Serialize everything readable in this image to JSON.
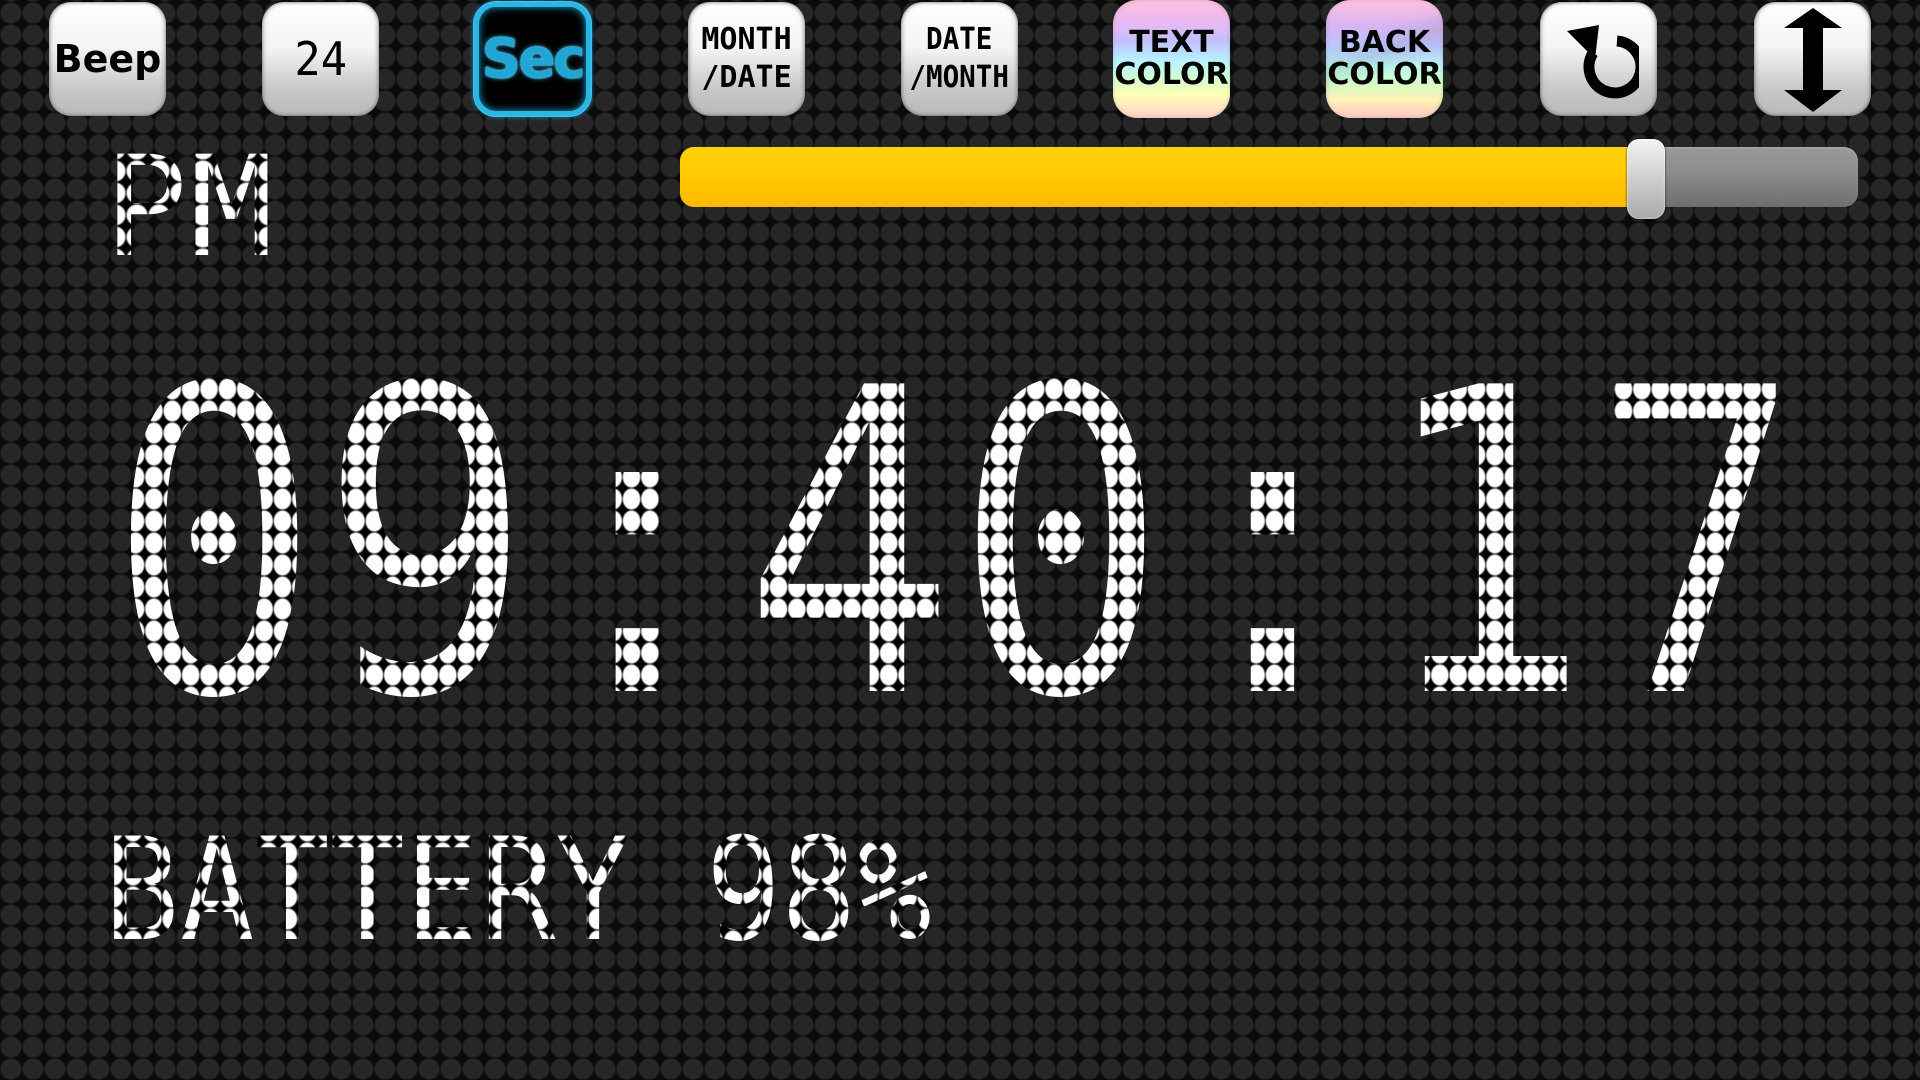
{
  "toolbar": {
    "beep_label": "Beep",
    "format24_label": "24",
    "seconds_label": "Sec",
    "month_date_label": "MONTH\n/DATE",
    "date_month_label": "DATE\n/MONTH",
    "text_color_label": "TEXT\nCOLOR",
    "back_color_label": "BACK\nCOLOR",
    "rotate_icon": "rotate-cw-icon",
    "orientation_icon": "vertical-arrows-icon",
    "seconds_active": true
  },
  "brightness": {
    "value_fraction": 0.82,
    "fill_color": "#ffc800",
    "track_color": "#8b8b8b"
  },
  "clock": {
    "ampm": "PM",
    "time": "09:40:17",
    "battery": "BATTERY 98%"
  },
  "colors": {
    "text": "#ffffff",
    "background": "#262626",
    "sec_glow": "#1ea6d6"
  }
}
